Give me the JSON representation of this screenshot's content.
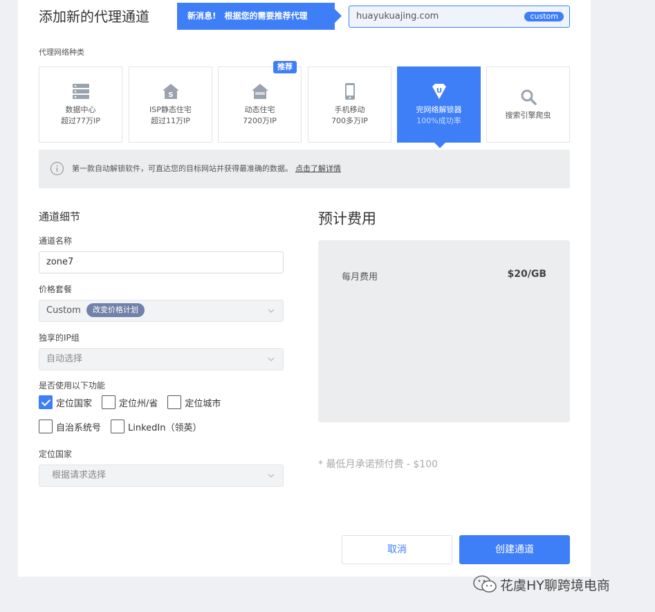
{
  "header": {
    "title": "添加新的代理通道",
    "banner_new": "新消息!",
    "banner_text": "根据您的需要推荐代理",
    "domain": "huayukuajing.com",
    "domain_tag": "custom"
  },
  "proxy_types": {
    "label": "代理网络种类",
    "badge": "推荐",
    "cards": [
      {
        "name": "数据中心",
        "sub": "超过77万IP",
        "icon": "server-icon"
      },
      {
        "name": "ISP静态住宅",
        "sub": "超过11万IP",
        "icon": "house-s-icon"
      },
      {
        "name": "动态住宅",
        "sub": "7200万IP",
        "icon": "house-icon"
      },
      {
        "name": "手机移动",
        "sub": "700多万IP",
        "icon": "mobile-icon"
      },
      {
        "name": "完网络解锁器",
        "sub": "100%成功率",
        "icon": "unlocker-icon"
      },
      {
        "name": "搜索引擎爬虫",
        "icon": "search-icon"
      }
    ]
  },
  "info": {
    "text": "第一款自动解锁软件，可直达您的目标网站并获得最准确的数据。",
    "link": "点击了解详情"
  },
  "form": {
    "section_title": "通道细节",
    "name_label": "通道名称",
    "name_value": "zone7",
    "plan_label": "价格套餐",
    "plan_value": "Custom",
    "plan_pill": "改变价格计划",
    "ip_group_label": "独享的IP组",
    "ip_group_value": "自动选择",
    "features_label": "是否使用以下功能",
    "features": [
      {
        "label": "定位国家",
        "checked": true
      },
      {
        "label": "定位州/省",
        "checked": false
      },
      {
        "label": "定位城市",
        "checked": false
      },
      {
        "label": "自治系统号",
        "checked": false
      },
      {
        "label": "LinkedIn（领英）",
        "checked": false
      }
    ],
    "country_label": "定位国家",
    "country_value": "根据请求选择"
  },
  "cost": {
    "title": "预计费用",
    "monthly_label": "每月费用",
    "monthly_value": "$20/GB",
    "min_note": "* 最低月承诺预付费 - $100"
  },
  "buttons": {
    "cancel": "取消",
    "create": "创建通道"
  },
  "watermark": "花虞HY聊跨境电商",
  "colors": {
    "accent": "#3e7ef7",
    "pill": "#7181a8"
  }
}
